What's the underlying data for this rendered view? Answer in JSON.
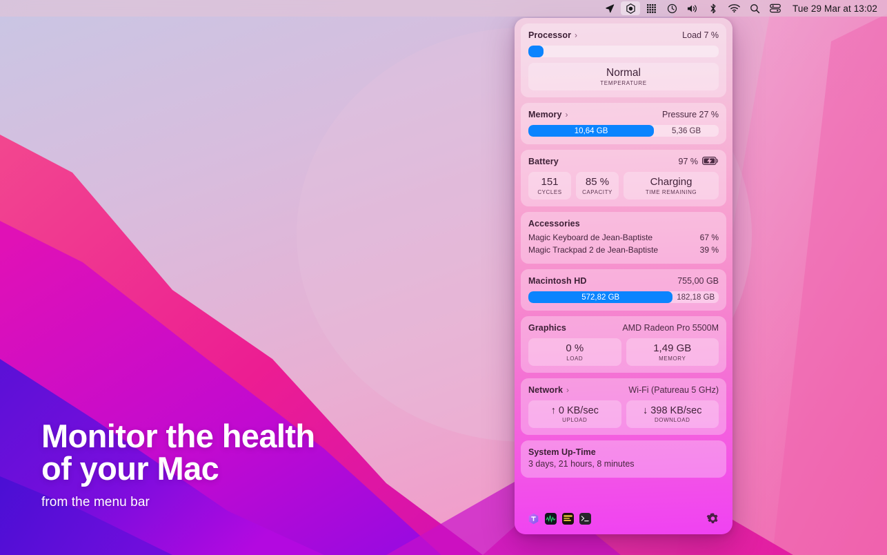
{
  "menubar": {
    "icons": [
      {
        "name": "location-arrow-icon",
        "glyph": "➤"
      },
      {
        "name": "screen-recording-icon",
        "glyph": "◉"
      },
      {
        "name": "control-grid-icon",
        "glyph": "▦"
      },
      {
        "name": "time-machine-icon",
        "glyph": "◷"
      },
      {
        "name": "volume-icon",
        "glyph": "🔊"
      },
      {
        "name": "bluetooth-icon",
        "glyph": "✳"
      },
      {
        "name": "wifi-icon",
        "glyph": "◗"
      },
      {
        "name": "search-icon",
        "glyph": "🔍"
      },
      {
        "name": "control-center-icon",
        "glyph": "▤"
      }
    ],
    "clock": "Tue 29 Mar at  13:02"
  },
  "panel": {
    "processor": {
      "title": "Processor",
      "chevron": "›",
      "right": "Load 7 %",
      "load_percent": 7,
      "temperature_value": "Normal",
      "temperature_label": "TEMPERATURE"
    },
    "memory": {
      "title": "Memory",
      "chevron": "›",
      "right": "Pressure 27 %",
      "used": "10,64 GB",
      "free": "5,36 GB",
      "used_percent": 66
    },
    "battery": {
      "title": "Battery",
      "right": "97 %",
      "percent": 97,
      "cycles_value": "151",
      "cycles_label": "CYCLES",
      "capacity_value": "85 %",
      "capacity_label": "CAPACITY",
      "status_value": "Charging",
      "status_label": "TIME REMAINING"
    },
    "accessories": {
      "title": "Accessories",
      "items": [
        {
          "name": "Magic Keyboard de Jean-Baptiste",
          "level": "67 %"
        },
        {
          "name": "Magic Trackpad 2 de Jean-Baptiste",
          "level": "39 %"
        }
      ]
    },
    "disk": {
      "title": "Macintosh HD",
      "right": "755,00 GB",
      "used": "572,82 GB",
      "free": "182,18 GB",
      "used_percent": 75.9
    },
    "graphics": {
      "title": "Graphics",
      "right": "AMD Radeon Pro 5500M",
      "load_value": "0 %",
      "load_label": "LOAD",
      "memory_value": "1,49 GB",
      "memory_label": "MEMORY"
    },
    "network": {
      "title": "Network",
      "chevron": "›",
      "right": "Wi-Fi (Patureau 5 GHz)",
      "upload_value": "↑ 0 KB/sec",
      "upload_label": "UPLOAD",
      "download_value": "↓ 398 KB/sec",
      "download_label": "DOWNLOAD"
    },
    "uptime": {
      "title": "System Up-Time",
      "value": "3 days, 21 hours, 8 minutes"
    },
    "footer": {
      "apps": [
        {
          "name": "app-icon-1"
        },
        {
          "name": "app-icon-2"
        },
        {
          "name": "app-icon-3"
        },
        {
          "name": "app-icon-4"
        }
      ],
      "settings_label": "Settings"
    }
  },
  "headline": {
    "line1": "Monitor the health",
    "line2": "of your Mac",
    "sub": "from the menu bar"
  },
  "colors": {
    "accent_blue": "#0b84fe",
    "panel_top": "#f2cfe2",
    "panel_bottom": "#f042f2"
  }
}
